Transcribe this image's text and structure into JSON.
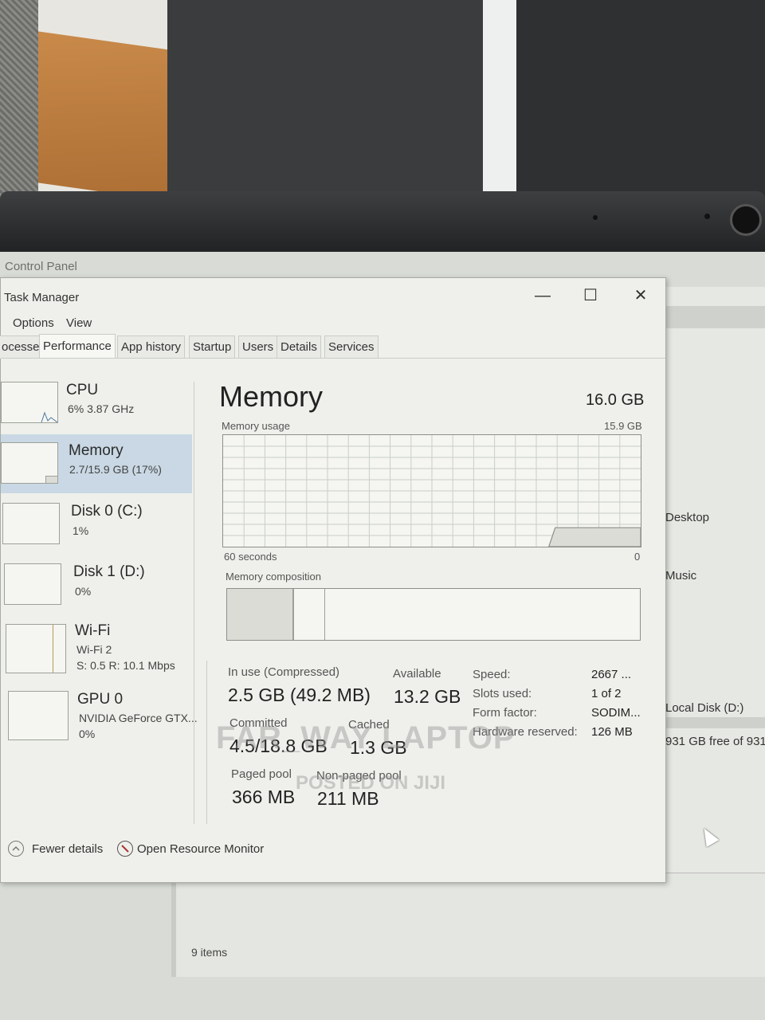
{
  "background": {
    "control_panel_title": "Control Panel"
  },
  "window": {
    "title": "Task Manager",
    "controls": {
      "minimize": "—",
      "maximize": "☐",
      "close": "✕"
    }
  },
  "menu": {
    "options": "Options",
    "view": "View"
  },
  "tabs": [
    {
      "label": "ocesses"
    },
    {
      "label": "Performance"
    },
    {
      "label": "App history"
    },
    {
      "label": "Startup"
    },
    {
      "label": "Users"
    },
    {
      "label": "Details"
    },
    {
      "label": "Services"
    }
  ],
  "sidebar": {
    "cpu": {
      "name": "CPU",
      "sub": "6% 3.87 GHz"
    },
    "memory": {
      "name": "Memory",
      "sub": "2.7/15.9 GB (17%)"
    },
    "disk0": {
      "name": "Disk 0 (C:)",
      "sub": "1%"
    },
    "disk1": {
      "name": "Disk 1 (D:)",
      "sub": "0%"
    },
    "wifi": {
      "name": "Wi-Fi",
      "sub1": "Wi-Fi 2",
      "sub2": "S: 0.5 R: 10.1 Mbps"
    },
    "gpu": {
      "name": "GPU 0",
      "sub1": "NVIDIA GeForce GTX...",
      "sub2": "0%"
    }
  },
  "memory": {
    "title": "Memory",
    "total": "16.0 GB",
    "usage_label": "Memory usage",
    "usage_max": "15.9 GB",
    "time_left": "60 seconds",
    "time_right": "0",
    "usage_fraction": 0.17,
    "composition_label": "Memory composition",
    "stats": {
      "in_use_label": "In use (Compressed)",
      "in_use_value": "2.5 GB (49.2 MB)",
      "available_label": "Available",
      "available_value": "13.2 GB",
      "committed_label": "Committed",
      "committed_value": "4.5/18.8 GB",
      "cached_label": "Cached",
      "cached_value": "1.3 GB",
      "paged_label": "Paged pool",
      "paged_value": "366 MB",
      "nonpaged_label": "Non-paged pool",
      "nonpaged_value": "211 MB"
    },
    "details": {
      "speed_key": "Speed:",
      "speed_val": "2667 ...",
      "slots_key": "Slots used:",
      "slots_val": "1 of 2",
      "form_key": "Form factor:",
      "form_val": "SODIM...",
      "hw_key": "Hardware reserved:",
      "hw_val": "126 MB"
    }
  },
  "footer": {
    "fewer_details": "Fewer details",
    "resource_monitor": "Open Resource Monitor"
  },
  "explorer": {
    "desktop": "Desktop",
    "music": "Music",
    "local_disk": "Local Disk (D:)",
    "free": "931 GB free of 931",
    "items": "9 items"
  },
  "watermark": {
    "line1": "FAR_WAY LAPTOP",
    "line2": "POSTED ON JIJI"
  }
}
